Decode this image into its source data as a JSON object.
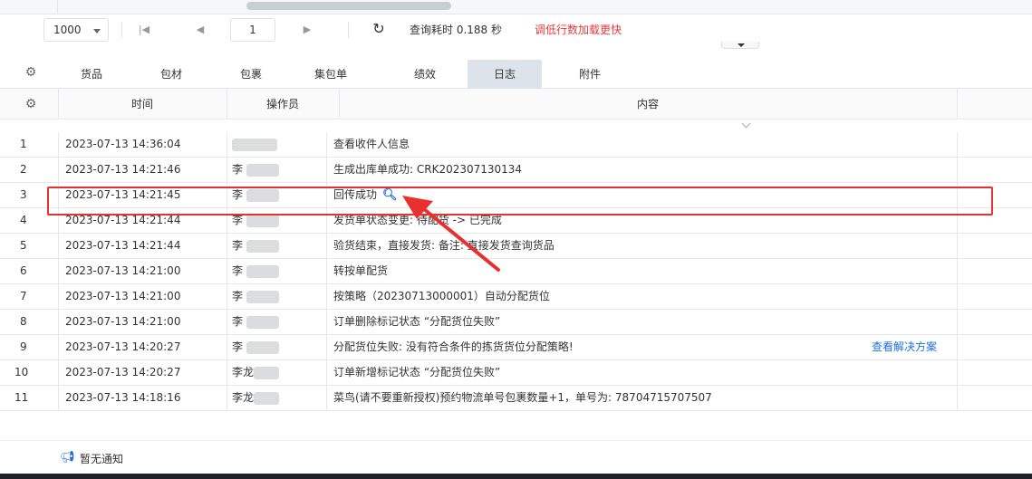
{
  "pager": {
    "page_size": "1000",
    "current_page": "1",
    "query_time": "查询耗时 0.188 秒",
    "tip": "调低行数加载更快"
  },
  "tabs": [
    {
      "label": "货品",
      "active": false
    },
    {
      "label": "包材",
      "active": false
    },
    {
      "label": "包裹",
      "active": false
    },
    {
      "label": "集包单",
      "active": false
    },
    {
      "label": "绩效",
      "active": false
    },
    {
      "label": "日志",
      "active": true
    },
    {
      "label": "附件",
      "active": false
    }
  ],
  "columns": {
    "time": "时间",
    "operator": "操作员",
    "content": "内容"
  },
  "rows": [
    {
      "idx": "1",
      "time": "2023-07-13 14:36:04",
      "operator": "",
      "content": "查看收件人信息"
    },
    {
      "idx": "2",
      "time": "2023-07-13 14:21:46",
      "operator": "李",
      "content": "生成出库单成功: CRK202307130134"
    },
    {
      "idx": "3",
      "time": "2023-07-13 14:21:45",
      "operator": "李",
      "content": "回传成功"
    },
    {
      "idx": "4",
      "time": "2023-07-13 14:21:44",
      "operator": "李",
      "content": "发货单状态变更: 待配货 -> 已完成"
    },
    {
      "idx": "5",
      "time": "2023-07-13 14:21:44",
      "operator": "李",
      "content": "验货结束，直接发货: 备注: 直接发货查询货品"
    },
    {
      "idx": "6",
      "time": "2023-07-13 14:21:00",
      "operator": "李",
      "content": "转按单配货"
    },
    {
      "idx": "7",
      "time": "2023-07-13 14:21:00",
      "operator": "李",
      "content": "按策略（20230713000001）自动分配货位"
    },
    {
      "idx": "8",
      "time": "2023-07-13 14:21:00",
      "operator": "李",
      "content": "订单删除标记状态 “分配货位失败”"
    },
    {
      "idx": "9",
      "time": "2023-07-13 14:20:27",
      "operator": "李",
      "content": "分配货位失败: 没有符合条件的拣货货位分配策略!",
      "action": "查看解决方案"
    },
    {
      "idx": "10",
      "time": "2023-07-13 14:20:27",
      "operator": "李龙",
      "content": "订单新增标记状态 “分配货位失败”"
    },
    {
      "idx": "11",
      "time": "2023-07-13 14:18:16",
      "operator": "李龙",
      "content": "菜鸟(请不要重新授权)预约物流单号包裹数量+1，单号为: 78704715707507"
    }
  ],
  "footer": {
    "notice": "暂无通知"
  },
  "colors": {
    "accent": "#1e6fe0",
    "highlight": "#e8302e",
    "tip": "#e4393c"
  }
}
